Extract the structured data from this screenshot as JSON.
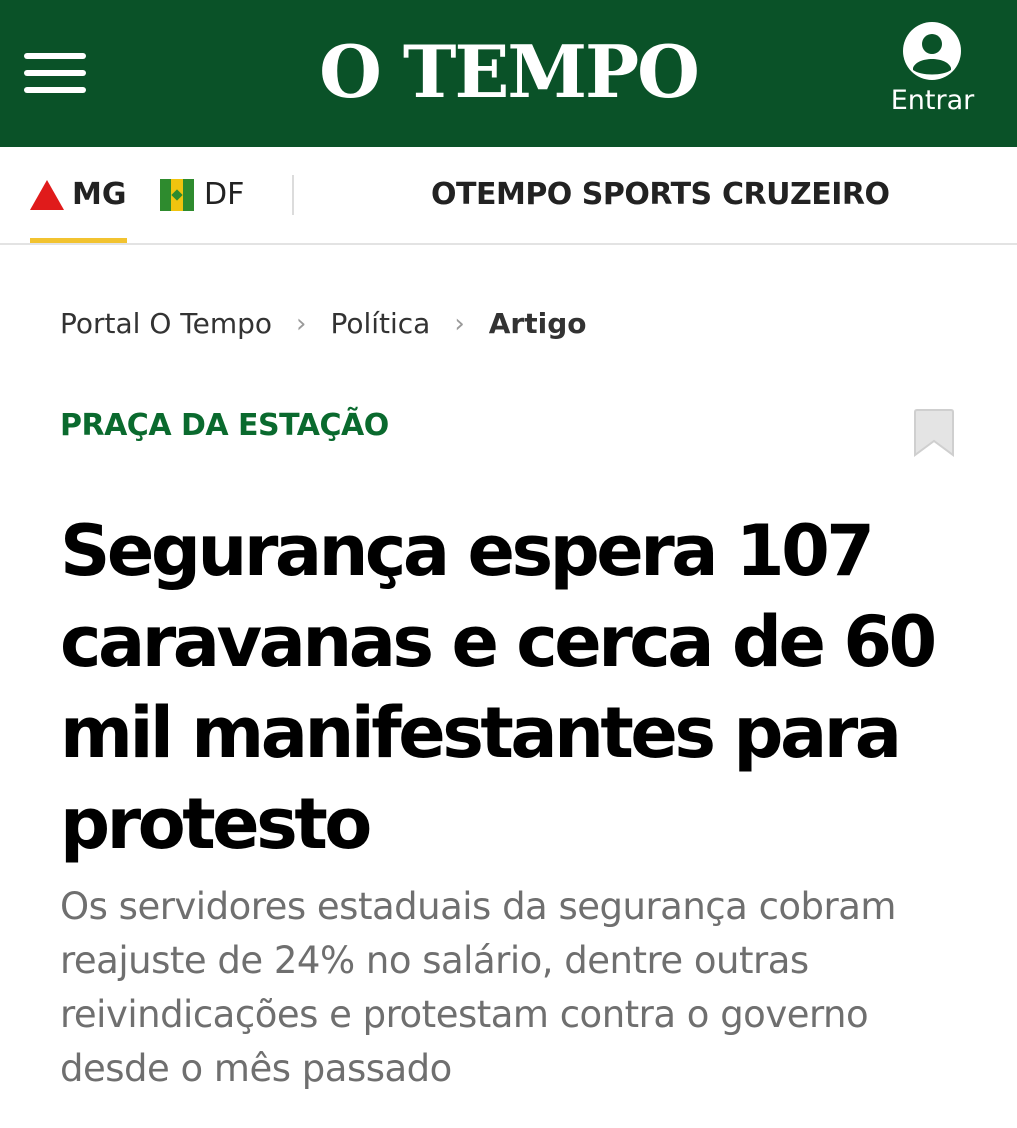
{
  "header": {
    "logo_text": "O TEMPO",
    "login_label": "Entrar",
    "background": "#0a5228",
    "menu_icon": "hamburger-menu-icon",
    "login_icon": "user-avatar-icon"
  },
  "nav": {
    "regions": [
      {
        "label": "MG",
        "icon": "triangle-icon",
        "active": true
      },
      {
        "label": "DF",
        "icon": "flag-icon",
        "active": false
      }
    ],
    "links": [
      "OTEMPO SPORTS",
      "CRUZEIRO"
    ],
    "active_indicator_color": "#f2c330"
  },
  "breadcrumb": {
    "items": [
      "Portal O Tempo",
      "Política",
      "Artigo"
    ],
    "separator": "›"
  },
  "article": {
    "section": "PRAÇA DA ESTAÇÃO",
    "section_color": "#0a6a2e",
    "bookmark_icon": "bookmark-icon",
    "headline": "Segurança espera 107 caravanas e cerca de 60 mil manifestantes para protesto",
    "subtitle": "Os servidores estaduais da segurança cobram reajuste de 24% no salário, dentre outras reivindicações e protestam contra o governo desde o mês passado"
  }
}
